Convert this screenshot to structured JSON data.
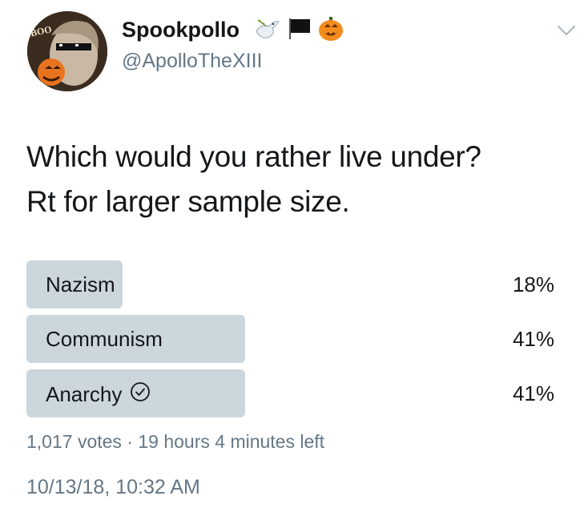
{
  "user": {
    "display_name": "Spookpollo",
    "handle": "@ApolloTheXIII",
    "avatar_text": "BOO",
    "name_emojis": [
      "dove-emoji",
      "black-flag-emoji",
      "jack-o-lantern-emoji"
    ]
  },
  "tweet": {
    "lines": [
      "Which would you rather live under?",
      "Rt for larger sample size."
    ]
  },
  "poll": {
    "options": [
      {
        "label": "Nazism",
        "percent_label": "18%",
        "percent": 18,
        "selected": false
      },
      {
        "label": "Communism",
        "percent_label": "41%",
        "percent": 41,
        "selected": false
      },
      {
        "label": "Anarchy",
        "percent_label": "41%",
        "percent": 41,
        "selected": true
      }
    ],
    "bar_color": "#ccd6dd",
    "meta": "1,017 votes · 19 hours 4 minutes left"
  },
  "timestamp": "10/13/18, 10:32 AM",
  "colors": {
    "text": "#14171a",
    "secondary": "#657786"
  }
}
